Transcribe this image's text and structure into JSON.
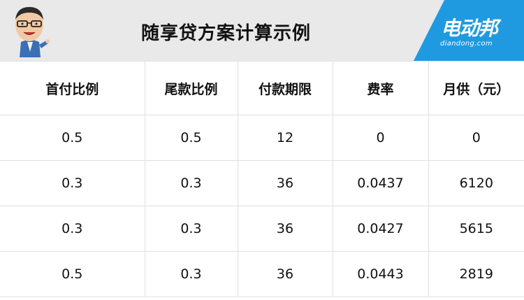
{
  "header": {
    "title": "随享贷方案计算示例",
    "logo_main": "电动邦",
    "logo_sub": "diandong.com",
    "colors": {
      "band": "#e9e9e9",
      "logo_bg": "#1f9ae0"
    }
  },
  "table": {
    "headers": [
      "首付比例",
      "尾款比例",
      "付款期限",
      "费率",
      "月供（元）"
    ],
    "rows": [
      [
        "0.5",
        "0.5",
        "12",
        "0",
        "0"
      ],
      [
        "0.3",
        "0.3",
        "36",
        "0.0437",
        "6120"
      ],
      [
        "0.3",
        "0.3",
        "36",
        "0.0427",
        "5615"
      ],
      [
        "0.5",
        "0.3",
        "36",
        "0.0443",
        "2819"
      ]
    ]
  }
}
